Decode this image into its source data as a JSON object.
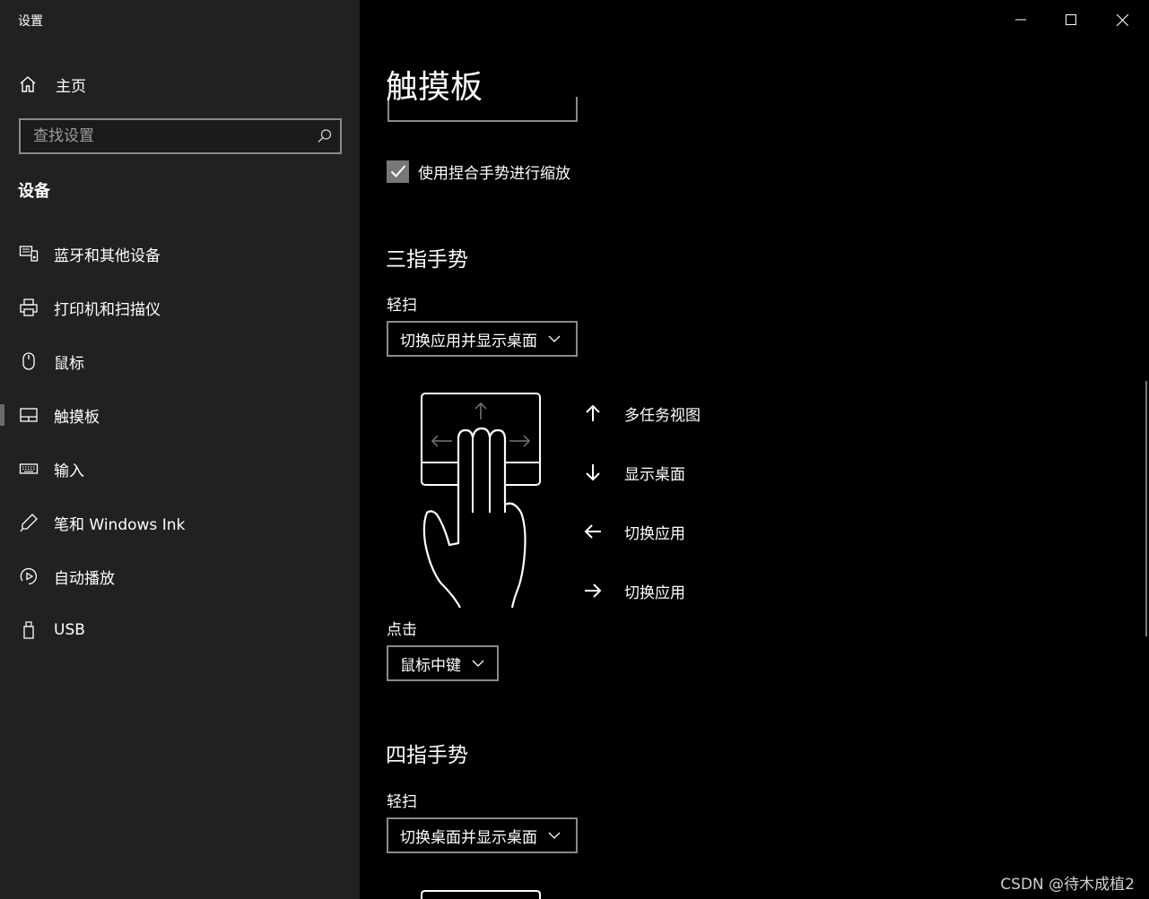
{
  "window": {
    "title": "设置"
  },
  "sidebar": {
    "home_label": "主页",
    "search_placeholder": "查找设置",
    "section_title": "设备",
    "items": [
      {
        "label": "蓝牙和其他设备",
        "icon": "bluetooth-devices-icon"
      },
      {
        "label": "打印机和扫描仪",
        "icon": "printer-icon"
      },
      {
        "label": "鼠标",
        "icon": "mouse-icon"
      },
      {
        "label": "触摸板",
        "icon": "touchpad-icon",
        "selected": true
      },
      {
        "label": "输入",
        "icon": "keyboard-icon"
      },
      {
        "label": "笔和 Windows Ink",
        "icon": "pen-icon"
      },
      {
        "label": "自动播放",
        "icon": "autoplay-icon"
      },
      {
        "label": "USB",
        "icon": "usb-icon"
      }
    ]
  },
  "content": {
    "page_title": "触摸板",
    "pinch_zoom": {
      "label": "使用捏合手势进行缩放",
      "checked": true
    },
    "three_finger": {
      "title": "三指手势",
      "swipe_label": "轻扫",
      "swipe_value": "切换应用并显示桌面",
      "gestures": [
        {
          "direction": "up",
          "label": "多任务视图"
        },
        {
          "direction": "down",
          "label": "显示桌面"
        },
        {
          "direction": "left",
          "label": "切换应用"
        },
        {
          "direction": "right",
          "label": "切换应用"
        }
      ],
      "tap_label": "点击",
      "tap_value": "鼠标中键"
    },
    "four_finger": {
      "title": "四指手势",
      "swipe_label": "轻扫",
      "swipe_value": "切换桌面并显示桌面"
    }
  },
  "watermark": "CSDN @待木成植2"
}
